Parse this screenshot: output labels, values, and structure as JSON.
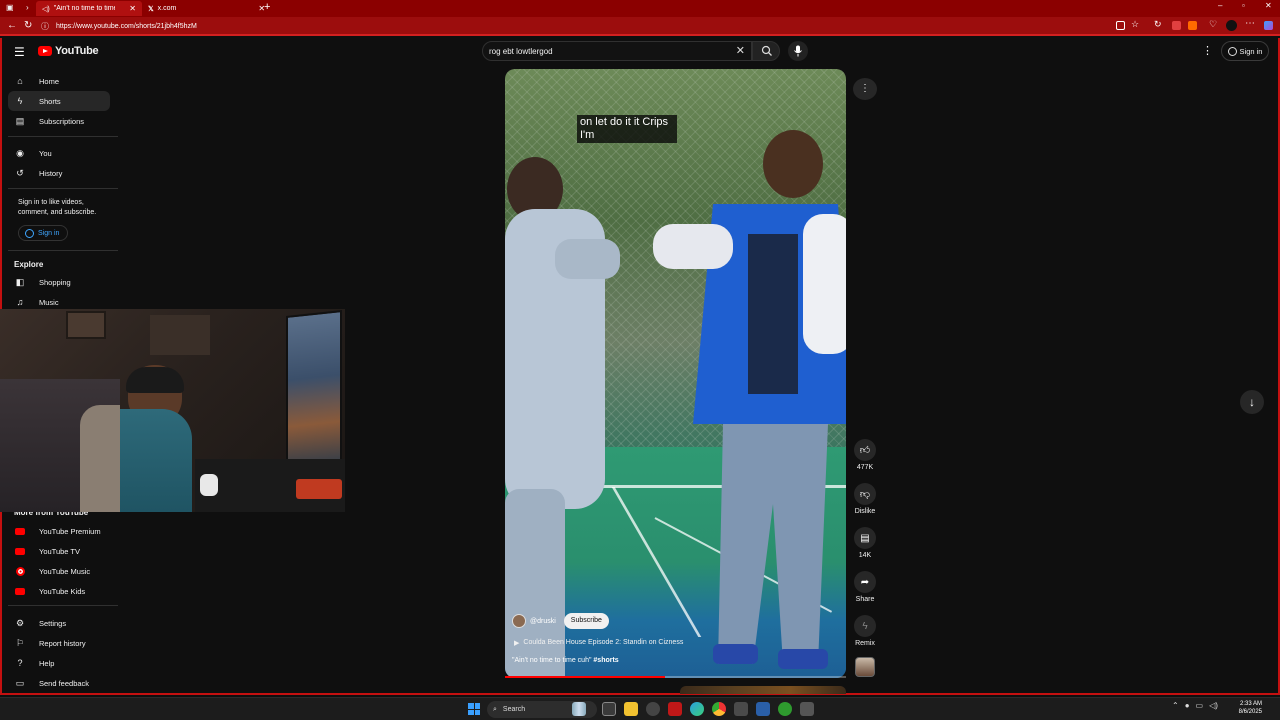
{
  "browser": {
    "tabs": [
      {
        "label": "\"Ain't no time to time cuh\" -",
        "active": true
      },
      {
        "label": "x.com",
        "active": false
      }
    ],
    "url": "https://www.youtube.com/shorts/21jbh4f5hzM",
    "window_controls": {
      "minimize": "–",
      "maximize": "▫",
      "close": "✕"
    }
  },
  "youtube": {
    "logo_text": "YouTube",
    "search_value": "rog ebt lowtlergod",
    "search_placeholder": "Search",
    "signin_label": "Sign in"
  },
  "sidebar": {
    "primary": [
      {
        "label": "Home",
        "icon": "home-icon",
        "active": false
      },
      {
        "label": "Shorts",
        "icon": "shorts-icon",
        "active": true
      },
      {
        "label": "Subscriptions",
        "icon": "subscriptions-icon",
        "active": false
      }
    ],
    "secondary": [
      {
        "label": "You",
        "icon": "you-icon"
      },
      {
        "label": "History",
        "icon": "history-icon"
      }
    ],
    "signin_prompt": "Sign in to like videos, comment, and subscribe.",
    "signin_label": "Sign in",
    "explore_heading": "Explore",
    "explore": [
      {
        "label": "Shopping",
        "icon": "shopping-icon"
      },
      {
        "label": "Music",
        "icon": "music-icon"
      }
    ],
    "more_heading": "More from YouTube",
    "more": [
      {
        "label": "YouTube Premium",
        "icon": "youtube-premium-icon"
      },
      {
        "label": "YouTube TV",
        "icon": "youtube-tv-icon"
      },
      {
        "label": "YouTube Music",
        "icon": "youtube-music-icon"
      },
      {
        "label": "YouTube Kids",
        "icon": "youtube-kids-icon"
      }
    ],
    "footer": [
      {
        "label": "Settings",
        "icon": "settings-icon"
      },
      {
        "label": "Report history",
        "icon": "flag-icon"
      },
      {
        "label": "Help",
        "icon": "help-icon"
      },
      {
        "label": "Send feedback",
        "icon": "feedback-icon"
      }
    ]
  },
  "short": {
    "caption": "on let do it it Crips I'm",
    "channel": "@druski",
    "subscribe_label": "Subscribe",
    "series": "Coulda Been House Episode 2: Standin on Cizness",
    "title": "\"Ain't no time to time cuh\"",
    "hashtag": "#shorts",
    "progress": 0.47,
    "actions": {
      "like_count": "477K",
      "dislike_label": "Dislike",
      "comment_count": "14K",
      "share_label": "Share",
      "remix_label": "Remix"
    }
  },
  "taskbar": {
    "search_label": "Search",
    "time": "2:33 AM",
    "date": "8/6/2025"
  }
}
